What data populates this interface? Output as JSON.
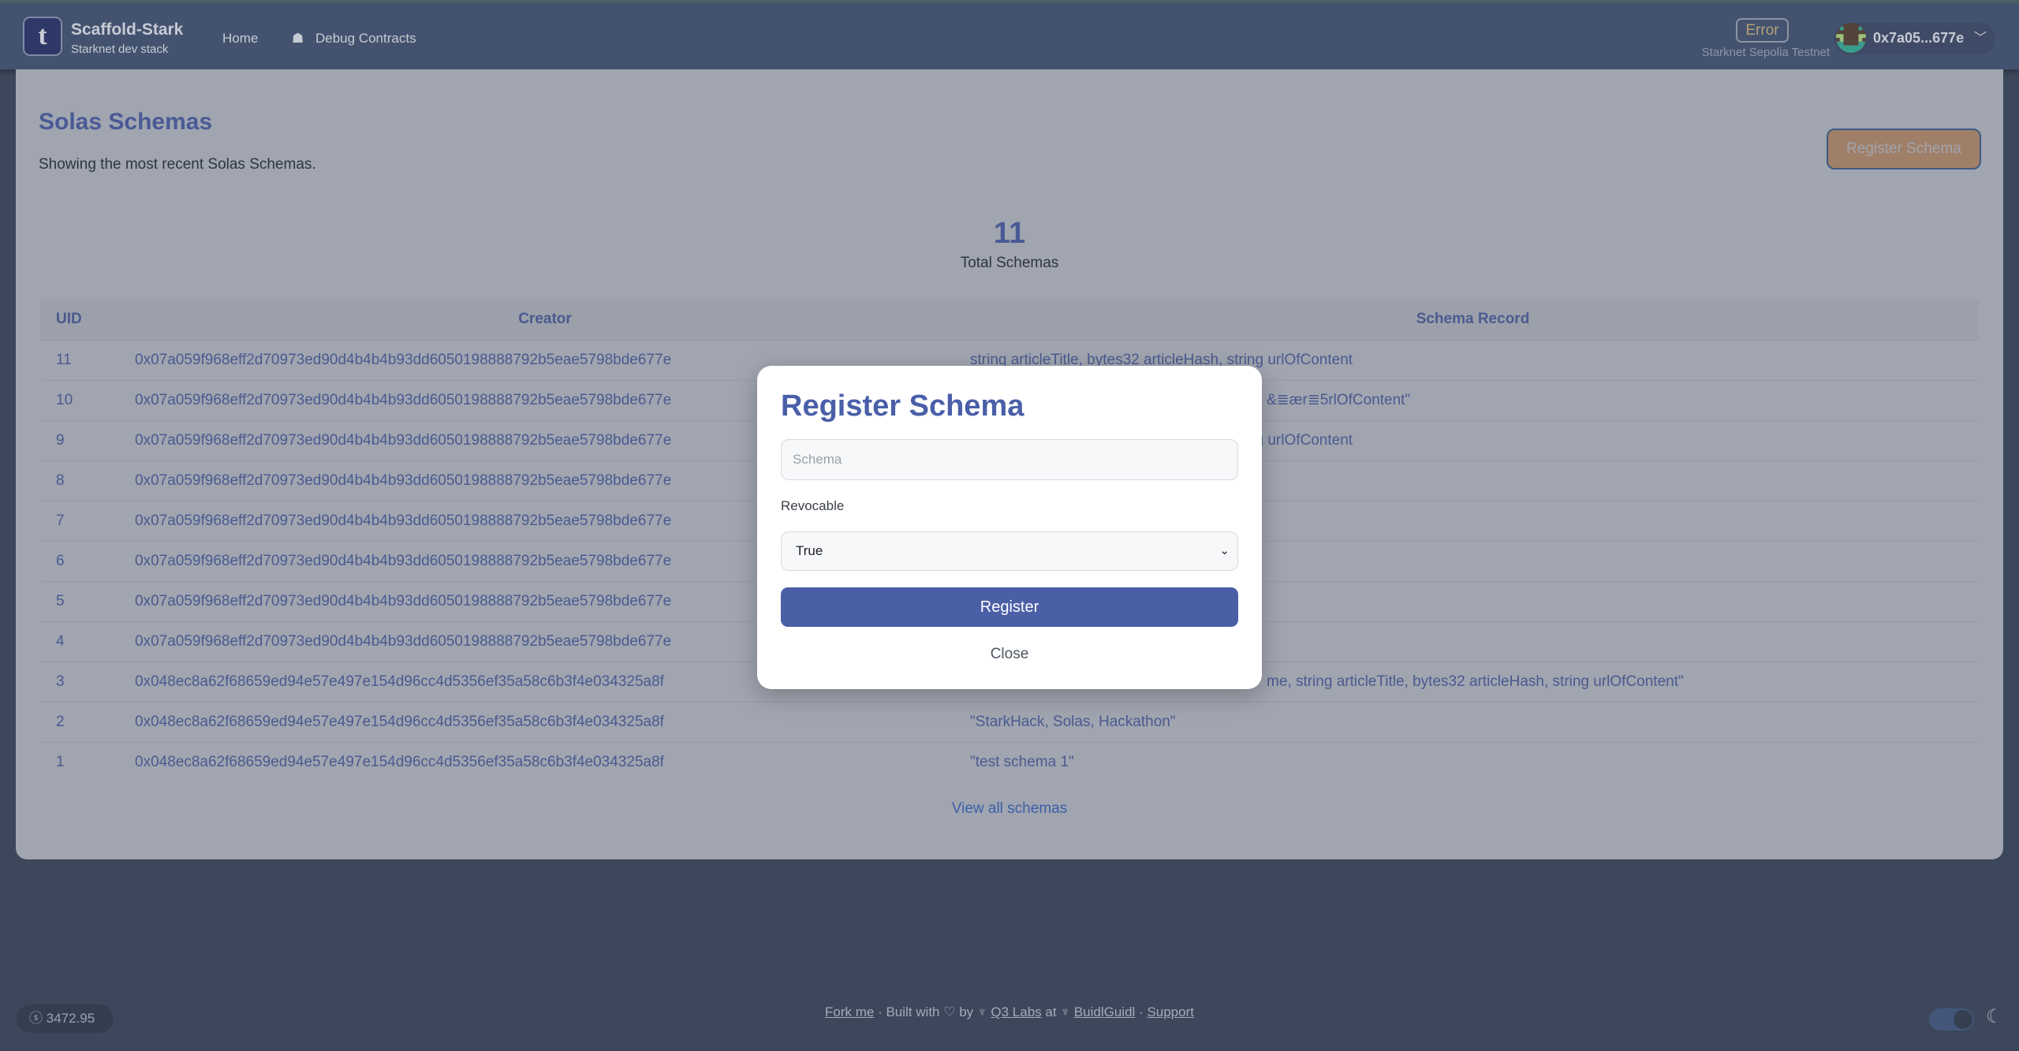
{
  "header": {
    "brand_title": "Scaffold-Stark",
    "brand_subtitle": "Starknet dev stack",
    "nav": [
      {
        "label": "Home"
      },
      {
        "label": "Debug Contracts",
        "icon": "bug-icon"
      }
    ],
    "network_status": "Error",
    "network_name": "Starknet Sepolia Testnet",
    "account_address": "0x7a05...677e"
  },
  "page": {
    "title": "Solas Schemas",
    "subtitle": "Showing the most recent Solas Schemas.",
    "register_button": "Register Schema",
    "total_count": "11",
    "total_label": "Total Schemas",
    "view_all": "View all schemas"
  },
  "table": {
    "columns": [
      "UID",
      "Creator",
      "Schema Record"
    ],
    "rows": [
      {
        "uid": "11",
        "creator": "0x07a059f968eff2d70973ed90d4b4b4b93dd6050198888792b5eae5798bde677e",
        "record": "string articleTitle, bytes32 articleHash, string urlOfContent"
      },
      {
        "uid": "10",
        "creator": "0x07a059f968eff2d70973ed90d4b4b4b93dd6050198888792b5eae5798bde677e",
        "record_fragment": "&≣ær≣5rlOfContent\""
      },
      {
        "uid": "9",
        "creator": "0x07a059f968eff2d70973ed90d4b4b4b93dd6050198888792b5eae5798bde677e",
        "record": "string articleTitle, bytes32 articleHash, string urlOfContent"
      },
      {
        "uid": "8",
        "creator": "0x07a059f968eff2d70973ed90d4b4b4b93dd6050198888792b5eae5798bde677e"
      },
      {
        "uid": "7",
        "creator": "0x07a059f968eff2d70973ed90d4b4b4b93dd6050198888792b5eae5798bde677e"
      },
      {
        "uid": "6",
        "creator": "0x07a059f968eff2d70973ed90d4b4b4b93dd6050198888792b5eae5798bde677e"
      },
      {
        "uid": "5",
        "creator": "0x07a059f968eff2d70973ed90d4b4b4b93dd6050198888792b5eae5798bde677e"
      },
      {
        "uid": "4",
        "creator": "0x07a059f968eff2d70973ed90d4b4b4b93dd6050198888792b5eae5798bde677e"
      },
      {
        "uid": "3",
        "creator": "0x048ec8a62f68659ed94e57e497e154d96cc4d5356ef35a58c6b3f4e034325a8f",
        "record_fragment": "me, string articleTitle, bytes32 articleHash, string urlOfContent\""
      },
      {
        "uid": "2",
        "creator": "0x048ec8a62f68659ed94e57e497e154d96cc4d5356ef35a58c6b3f4e034325a8f",
        "record": "\"StarkHack, Solas, Hackathon\""
      },
      {
        "uid": "1",
        "creator": "0x048ec8a62f68659ed94e57e497e154d96cc4d5356ef35a58c6b3f4e034325a8f",
        "record": "\"test schema 1\""
      }
    ]
  },
  "modal": {
    "title": "Register Schema",
    "schema_placeholder": "Schema",
    "revocable_label": "Revocable",
    "revocable_value": "True",
    "register_button": "Register",
    "close_button": "Close"
  },
  "footer": {
    "price": "3472.95",
    "fork": "Fork me",
    "built_with": "Built with",
    "by": "by",
    "q3labs": "Q3 Labs",
    "at": "at",
    "buidlguidl": "BuidlGuidl",
    "support": "Support"
  },
  "colors": {
    "accent": "#4a5fa6",
    "title": "#4a5a96",
    "error": "#b6a077"
  }
}
